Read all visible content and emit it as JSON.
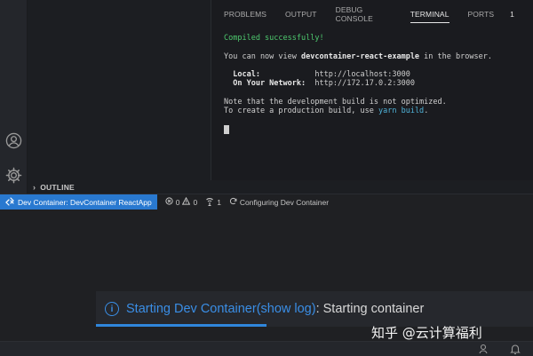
{
  "panel": {
    "tabs": [
      {
        "label": "PROBLEMS"
      },
      {
        "label": "OUTPUT"
      },
      {
        "label": "DEBUG CONSOLE"
      },
      {
        "label": "TERMINAL",
        "active": true
      },
      {
        "label": "PORTS",
        "badge": "1"
      }
    ]
  },
  "terminal": {
    "compiled": "Compiled successfully!",
    "view_prefix": "You can now view ",
    "app_name": "devcontainer-react-example",
    "view_suffix": " in the browser.",
    "local_label": "  Local:",
    "local_url": "http://localhost:3000",
    "network_label": "  On Your Network:",
    "network_url": "http://172.17.0.2:3000",
    "note_line": "Note that the development build is not optimized.",
    "build_prefix": "To create a production build, use ",
    "build_cmd": "yarn build",
    "build_suffix": "."
  },
  "sidebar": {
    "outline_label": "OUTLINE"
  },
  "statusbar": {
    "remote_label": "Dev Container: DevContainer ReactApp",
    "errors": "0",
    "warnings": "0",
    "ports": "1",
    "task_label": "Configuring Dev Container"
  },
  "notification": {
    "prefix": "Starting Dev Container ",
    "link": "(show log)",
    "suffix": ": Starting container",
    "progress": 0.39
  },
  "watermark": "知乎 @云计算福利",
  "colors": {
    "accent": "#2979d0",
    "success": "#4ec96e",
    "link": "#3a8ee6"
  },
  "icons": [
    "account-icon",
    "gear-icon",
    "remote-icon",
    "error-icon",
    "warning-icon",
    "ports-icon",
    "sync-icon",
    "info-icon",
    "feedback-icon",
    "bell-icon"
  ]
}
